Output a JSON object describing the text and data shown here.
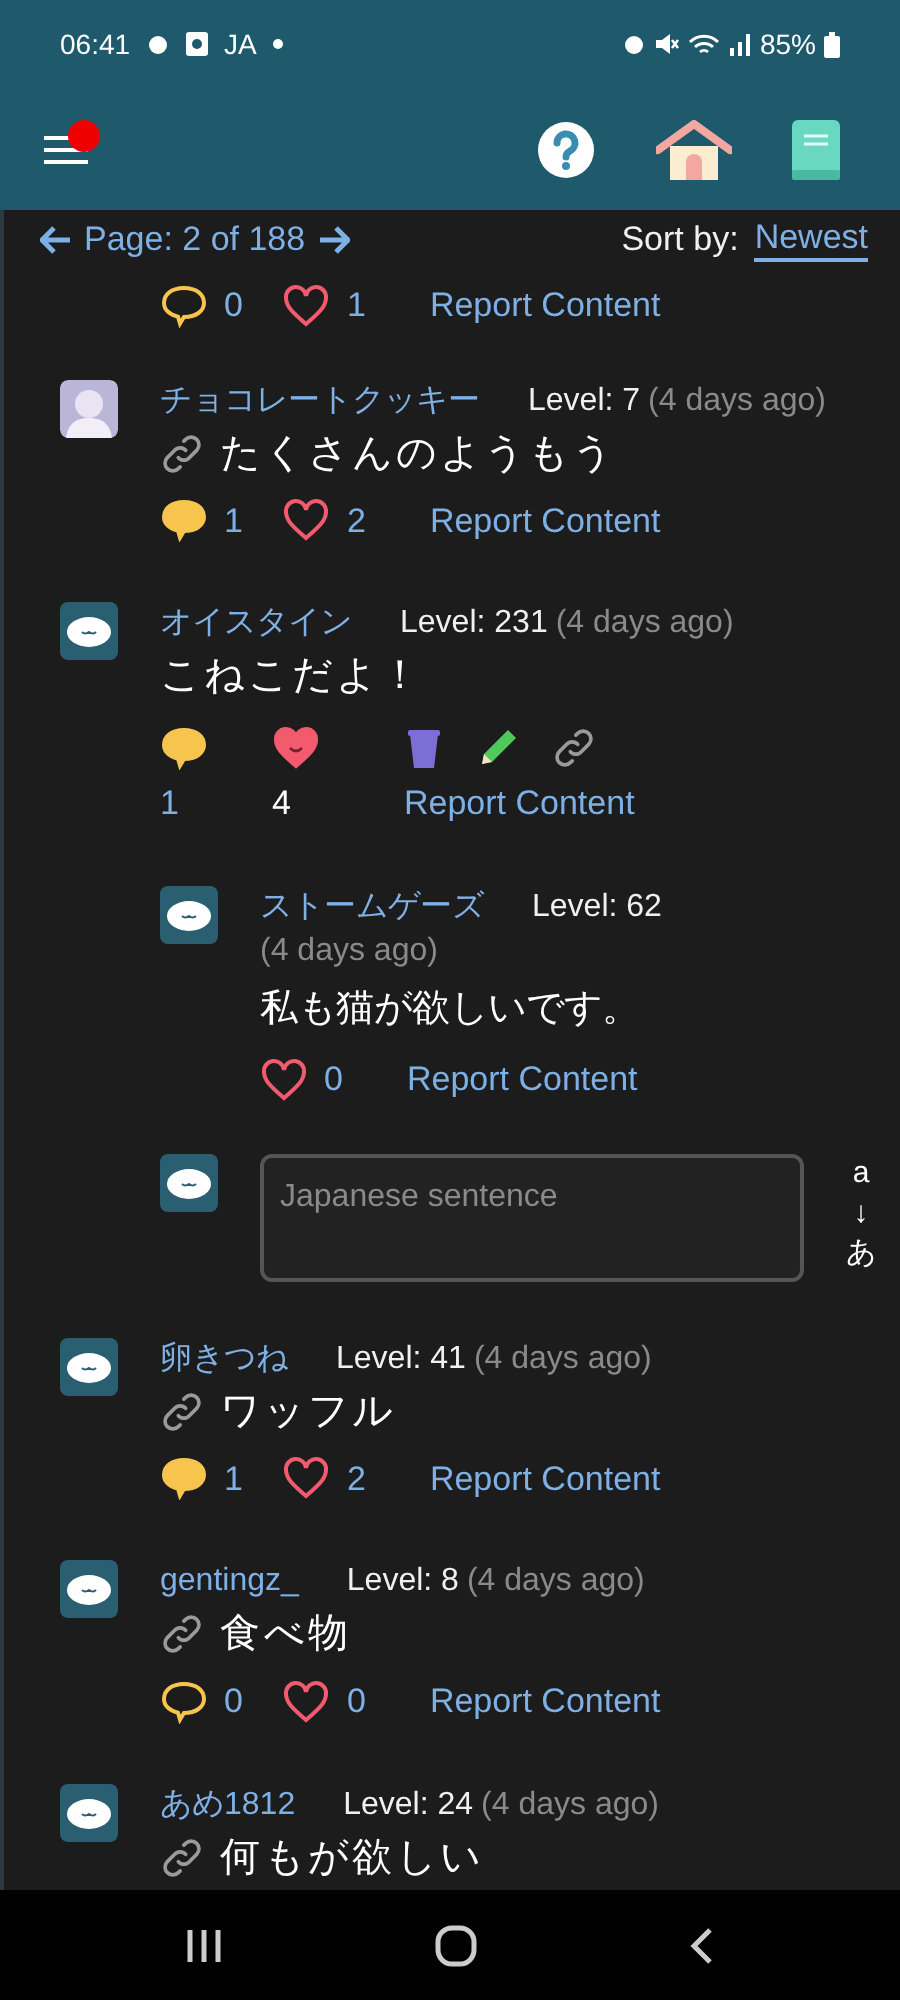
{
  "status_bar": {
    "time": "06:41",
    "ime": "JA",
    "battery": "85%"
  },
  "header": {
    "notification": true
  },
  "pager": {
    "page": "Page: 2 of 188",
    "sort_label": "Sort by:",
    "sort_value": "Newest"
  },
  "top_actions": {
    "comments": "0",
    "commented": false,
    "likes": "1",
    "liked": false,
    "report": "Report Content"
  },
  "posts": [
    {
      "kind": "standard",
      "avatar": {
        "kind": "photo"
      },
      "user": "チョコレートクッキー",
      "level": "Level: 7",
      "time": "(4 days ago)",
      "linked": true,
      "text": "たくさんのようもう",
      "comments": "1",
      "commented": true,
      "likes": "2",
      "liked": false,
      "report": "Report Content"
    },
    {
      "kind": "owner",
      "avatar": {
        "kind": "mascot"
      },
      "user": "オイスタイン",
      "level": "Level: 231",
      "time": "(4 days ago)",
      "linked": false,
      "text": "こねこだよ！",
      "comments": "1",
      "commented": true,
      "likes": "4",
      "liked": true,
      "report": "Report Content",
      "replies": [
        {
          "avatar": {
            "kind": "mascot"
          },
          "user": "ストームゲーズ",
          "level": "Level: 62",
          "time": "(4 days ago)",
          "text": "私も猫が欲しいです。",
          "likes": "0",
          "liked": false,
          "report": "Report Content"
        }
      ],
      "reply_box": {
        "placeholder": "Japanese sentence",
        "ime_from": "a",
        "ime_arrow": "↓",
        "ime_to": "あ"
      }
    },
    {
      "kind": "standard",
      "avatar": {
        "kind": "mascot"
      },
      "user": "卵きつね",
      "level": "Level: 41",
      "time": "(4 days ago)",
      "linked": true,
      "text": "ワッフル",
      "comments": "1",
      "commented": true,
      "likes": "2",
      "liked": false,
      "report": "Report Content"
    },
    {
      "kind": "standard",
      "avatar": {
        "kind": "mascot"
      },
      "user": "gentingz_",
      "level": "Level: 8",
      "time": "(4 days ago)",
      "linked": true,
      "text": "食べ物",
      "comments": "0",
      "commented": false,
      "likes": "0",
      "liked": false,
      "report": "Report Content"
    },
    {
      "avatar": {
        "kind": "mascot"
      },
      "user": "あめ1812",
      "level": "Level: 24",
      "time": "(4 days ago)",
      "linked": true,
      "text": "何もが欲しい"
    }
  ]
}
